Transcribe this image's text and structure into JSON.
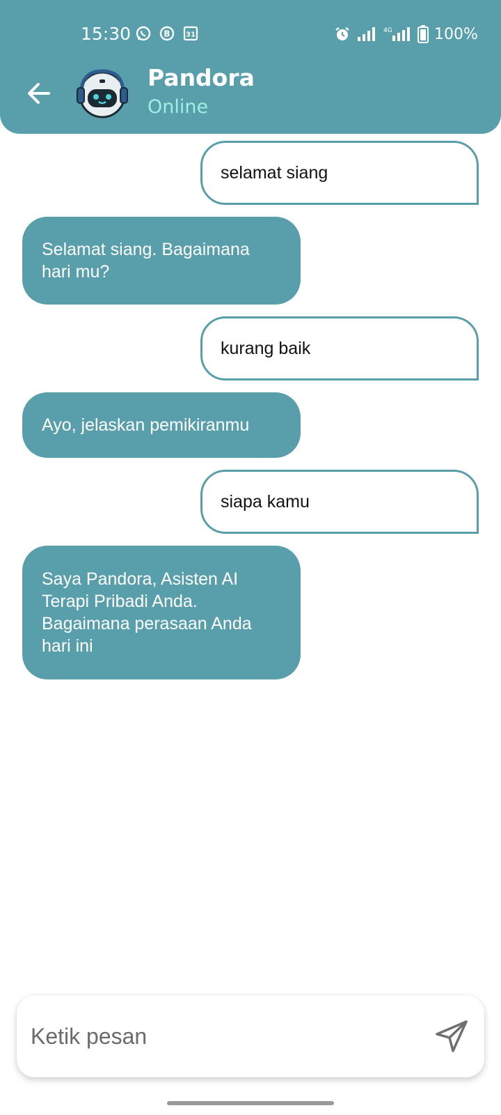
{
  "status_bar": {
    "time": "15:30",
    "battery": "100%",
    "icons_left": [
      "whatsapp-icon",
      "b-icon",
      "calendar-icon"
    ],
    "icons_right": [
      "alarm-icon",
      "signal-icon",
      "4g-signal-icon",
      "battery-icon"
    ],
    "calendar_day": "31",
    "b_badge": "B",
    "network": "4G"
  },
  "header": {
    "name": "Pandora",
    "status": "Online",
    "accent": "#589fab",
    "status_color": "#9ff0e2"
  },
  "messages": [
    {
      "from": "user",
      "text": "selamat siang"
    },
    {
      "from": "bot",
      "text": "Selamat siang. Bagaimana hari mu?"
    },
    {
      "from": "user",
      "text": "kurang baik"
    },
    {
      "from": "bot",
      "text": "Ayo, jelaskan pemikiranmu"
    },
    {
      "from": "user",
      "text": "siapa kamu"
    },
    {
      "from": "bot",
      "text": "Saya Pandora, Asisten AI Terapi Pribadi Anda. Bagaimana perasaan Anda hari ini"
    }
  ],
  "composer": {
    "placeholder": "Ketik pesan",
    "value": ""
  }
}
